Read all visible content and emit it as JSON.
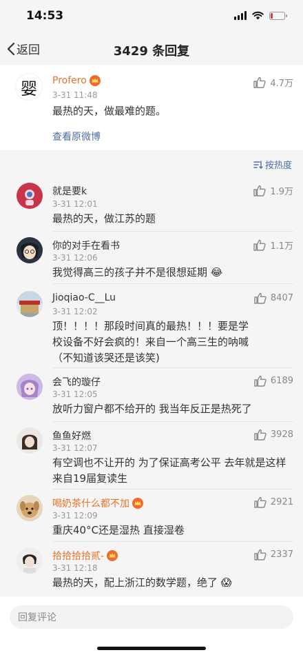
{
  "status_bar": {
    "time": "14:53",
    "battery_level": 0.15,
    "battery_color": "#e63b2e"
  },
  "nav": {
    "back_label": "返回",
    "title": "3429 条回复"
  },
  "post": {
    "author": "Profero",
    "time": "3-31 11:48",
    "text": "最热的天，做最难的题。",
    "likes": "4.7万",
    "view_original_label": "查看原微博",
    "avatar_glyph": "婴"
  },
  "sort": {
    "label": "按热度"
  },
  "comments": [
    {
      "name": "就是要k",
      "name_style": "dark",
      "vip": false,
      "time": "3-31 12:01",
      "text": "最热的天，做江苏的题",
      "likes": "1.9万",
      "avatar": "red-astronaut-avatar"
    },
    {
      "name": "你的对手在看书",
      "name_style": "dark",
      "vip": false,
      "time": "3-31 12:06",
      "text": "我觉得高三的孩子并不是很想延期 😂",
      "likes": "1.1万",
      "avatar": "anime-boy-avatar"
    },
    {
      "name": "Jioqiao-C__Lu",
      "name_style": "dark",
      "vip": false,
      "time": "3-31 12:02",
      "text": "顶！！！！那段时间真的最热！！！要是学校设备不好会疯的！来自一个高三生的呐喊（不知道该哭还是该笑)",
      "likes": "8407",
      "avatar": "building-avatar"
    },
    {
      "name": "会飞的璇仔",
      "name_style": "dark",
      "vip": false,
      "time": "3-31 12:05",
      "text": "放听力窗户都不给开的 我当年反正是热死了",
      "likes": "6189",
      "avatar": "anime-girl-avatar"
    },
    {
      "name": "鱼鱼好燃",
      "name_style": "dark",
      "vip": false,
      "time": "3-31 12:07",
      "text": "有空调也不让开的 为了保证高考公平 去年就是这样来自19届复读生",
      "likes": "3928",
      "avatar": "girl-photo-avatar"
    },
    {
      "name": "喝奶茶什么都不加",
      "name_style": "orange",
      "vip": true,
      "time": "3-31 12:09",
      "text": "重庆40°C还是湿热 直接湿卷",
      "likes": "2921",
      "avatar": "dog-avatar"
    },
    {
      "name": "拾拾拾拾贰-",
      "name_style": "orange",
      "vip": true,
      "time": "3-31 12:18",
      "text": "最热的天，配上浙江的数学题，绝了 😱",
      "likes": "2337",
      "avatar": "person-photo-avatar"
    }
  ],
  "reply": {
    "placeholder": "回复评论"
  }
}
